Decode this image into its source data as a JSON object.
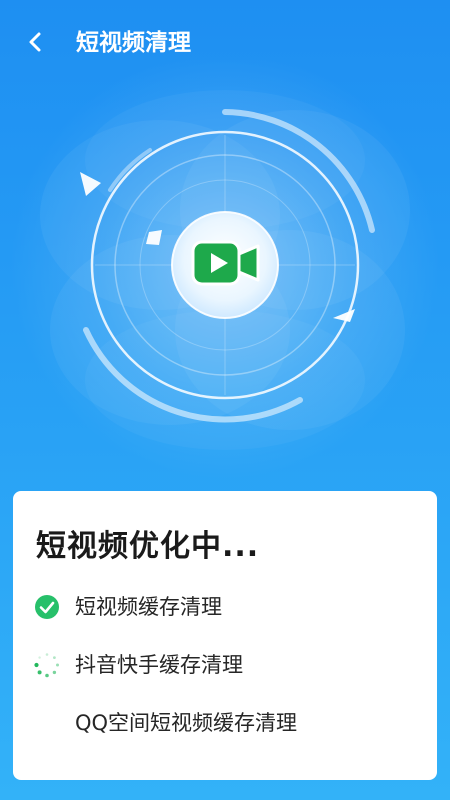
{
  "header": {
    "back_icon": "chevron-left-icon",
    "title": "短视频清理"
  },
  "scanner": {
    "center_icon": "video-camera-icon",
    "accent_color": "#1ea94b"
  },
  "card": {
    "title": "短视频优化中...",
    "tasks": [
      {
        "label": "短视频缓存清理",
        "status": "done",
        "icon": "check-circle-icon"
      },
      {
        "label": "抖音快手缓存清理",
        "status": "in-progress",
        "icon": "loading-spinner-icon"
      },
      {
        "label": "QQ空间短视频缓存清理",
        "status": "pending",
        "icon": ""
      }
    ]
  },
  "colors": {
    "background_top": "#1e8ff2",
    "background_bottom": "#33b2f8",
    "done_green": "#27c06a",
    "spinner_green": "#22b85c"
  }
}
